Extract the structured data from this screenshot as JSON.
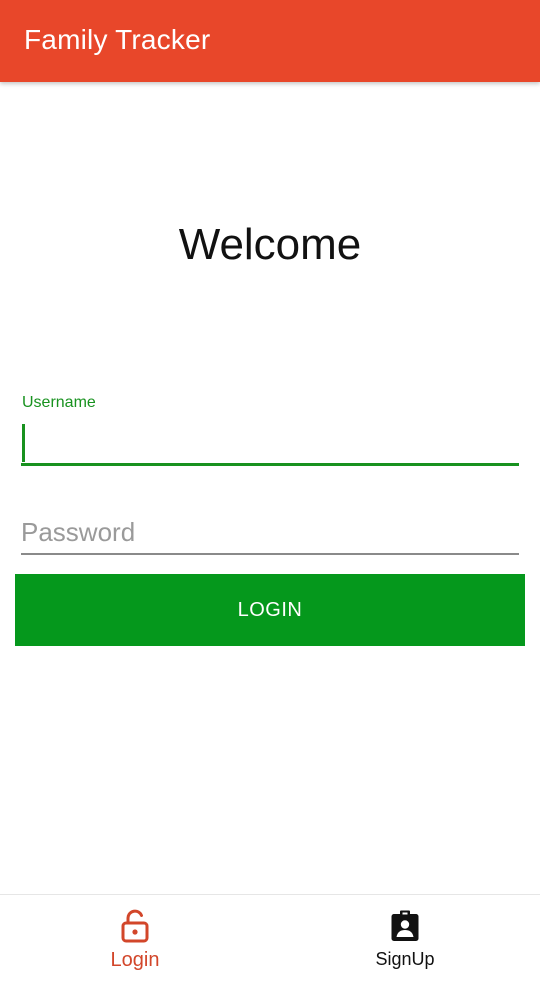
{
  "appbar": {
    "title": "Family Tracker",
    "color": "#e8472a"
  },
  "main": {
    "heading": "Welcome",
    "username": {
      "label": "Username",
      "value": ""
    },
    "password": {
      "placeholder": "Password",
      "value": ""
    },
    "login_button": {
      "label": "LOGIN",
      "color": "#05981c"
    }
  },
  "bottom_nav": {
    "items": [
      {
        "label": "Login",
        "icon": "lock-open-icon",
        "active": true,
        "color": "#d2462a"
      },
      {
        "label": "SignUp",
        "icon": "badge-account-icon",
        "active": false,
        "color": "#111111"
      }
    ]
  }
}
